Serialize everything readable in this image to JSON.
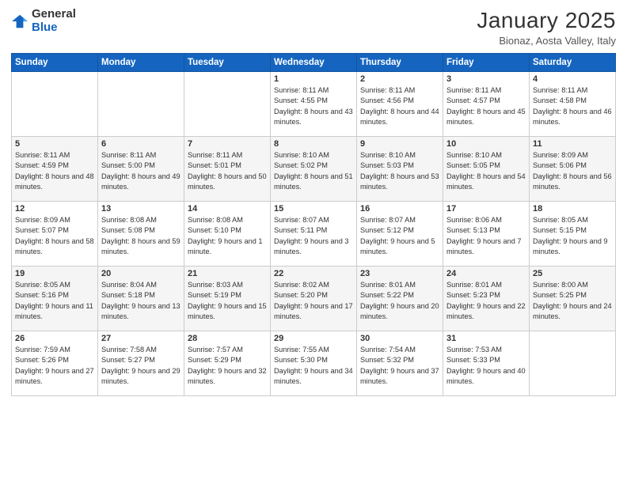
{
  "logo": {
    "general": "General",
    "blue": "Blue"
  },
  "title": "January 2025",
  "location": "Bionaz, Aosta Valley, Italy",
  "days_header": [
    "Sunday",
    "Monday",
    "Tuesday",
    "Wednesday",
    "Thursday",
    "Friday",
    "Saturday"
  ],
  "weeks": [
    [
      {
        "day": "",
        "info": ""
      },
      {
        "day": "",
        "info": ""
      },
      {
        "day": "",
        "info": ""
      },
      {
        "day": "1",
        "info": "Sunrise: 8:11 AM\nSunset: 4:55 PM\nDaylight: 8 hours\nand 43 minutes."
      },
      {
        "day": "2",
        "info": "Sunrise: 8:11 AM\nSunset: 4:56 PM\nDaylight: 8 hours\nand 44 minutes."
      },
      {
        "day": "3",
        "info": "Sunrise: 8:11 AM\nSunset: 4:57 PM\nDaylight: 8 hours\nand 45 minutes."
      },
      {
        "day": "4",
        "info": "Sunrise: 8:11 AM\nSunset: 4:58 PM\nDaylight: 8 hours\nand 46 minutes."
      }
    ],
    [
      {
        "day": "5",
        "info": "Sunrise: 8:11 AM\nSunset: 4:59 PM\nDaylight: 8 hours\nand 48 minutes."
      },
      {
        "day": "6",
        "info": "Sunrise: 8:11 AM\nSunset: 5:00 PM\nDaylight: 8 hours\nand 49 minutes."
      },
      {
        "day": "7",
        "info": "Sunrise: 8:11 AM\nSunset: 5:01 PM\nDaylight: 8 hours\nand 50 minutes."
      },
      {
        "day": "8",
        "info": "Sunrise: 8:10 AM\nSunset: 5:02 PM\nDaylight: 8 hours\nand 51 minutes."
      },
      {
        "day": "9",
        "info": "Sunrise: 8:10 AM\nSunset: 5:03 PM\nDaylight: 8 hours\nand 53 minutes."
      },
      {
        "day": "10",
        "info": "Sunrise: 8:10 AM\nSunset: 5:05 PM\nDaylight: 8 hours\nand 54 minutes."
      },
      {
        "day": "11",
        "info": "Sunrise: 8:09 AM\nSunset: 5:06 PM\nDaylight: 8 hours\nand 56 minutes."
      }
    ],
    [
      {
        "day": "12",
        "info": "Sunrise: 8:09 AM\nSunset: 5:07 PM\nDaylight: 8 hours\nand 58 minutes."
      },
      {
        "day": "13",
        "info": "Sunrise: 8:08 AM\nSunset: 5:08 PM\nDaylight: 8 hours\nand 59 minutes."
      },
      {
        "day": "14",
        "info": "Sunrise: 8:08 AM\nSunset: 5:10 PM\nDaylight: 9 hours\nand 1 minute."
      },
      {
        "day": "15",
        "info": "Sunrise: 8:07 AM\nSunset: 5:11 PM\nDaylight: 9 hours\nand 3 minutes."
      },
      {
        "day": "16",
        "info": "Sunrise: 8:07 AM\nSunset: 5:12 PM\nDaylight: 9 hours\nand 5 minutes."
      },
      {
        "day": "17",
        "info": "Sunrise: 8:06 AM\nSunset: 5:13 PM\nDaylight: 9 hours\nand 7 minutes."
      },
      {
        "day": "18",
        "info": "Sunrise: 8:05 AM\nSunset: 5:15 PM\nDaylight: 9 hours\nand 9 minutes."
      }
    ],
    [
      {
        "day": "19",
        "info": "Sunrise: 8:05 AM\nSunset: 5:16 PM\nDaylight: 9 hours\nand 11 minutes."
      },
      {
        "day": "20",
        "info": "Sunrise: 8:04 AM\nSunset: 5:18 PM\nDaylight: 9 hours\nand 13 minutes."
      },
      {
        "day": "21",
        "info": "Sunrise: 8:03 AM\nSunset: 5:19 PM\nDaylight: 9 hours\nand 15 minutes."
      },
      {
        "day": "22",
        "info": "Sunrise: 8:02 AM\nSunset: 5:20 PM\nDaylight: 9 hours\nand 17 minutes."
      },
      {
        "day": "23",
        "info": "Sunrise: 8:01 AM\nSunset: 5:22 PM\nDaylight: 9 hours\nand 20 minutes."
      },
      {
        "day": "24",
        "info": "Sunrise: 8:01 AM\nSunset: 5:23 PM\nDaylight: 9 hours\nand 22 minutes."
      },
      {
        "day": "25",
        "info": "Sunrise: 8:00 AM\nSunset: 5:25 PM\nDaylight: 9 hours\nand 24 minutes."
      }
    ],
    [
      {
        "day": "26",
        "info": "Sunrise: 7:59 AM\nSunset: 5:26 PM\nDaylight: 9 hours\nand 27 minutes."
      },
      {
        "day": "27",
        "info": "Sunrise: 7:58 AM\nSunset: 5:27 PM\nDaylight: 9 hours\nand 29 minutes."
      },
      {
        "day": "28",
        "info": "Sunrise: 7:57 AM\nSunset: 5:29 PM\nDaylight: 9 hours\nand 32 minutes."
      },
      {
        "day": "29",
        "info": "Sunrise: 7:55 AM\nSunset: 5:30 PM\nDaylight: 9 hours\nand 34 minutes."
      },
      {
        "day": "30",
        "info": "Sunrise: 7:54 AM\nSunset: 5:32 PM\nDaylight: 9 hours\nand 37 minutes."
      },
      {
        "day": "31",
        "info": "Sunrise: 7:53 AM\nSunset: 5:33 PM\nDaylight: 9 hours\nand 40 minutes."
      },
      {
        "day": "",
        "info": ""
      }
    ]
  ]
}
